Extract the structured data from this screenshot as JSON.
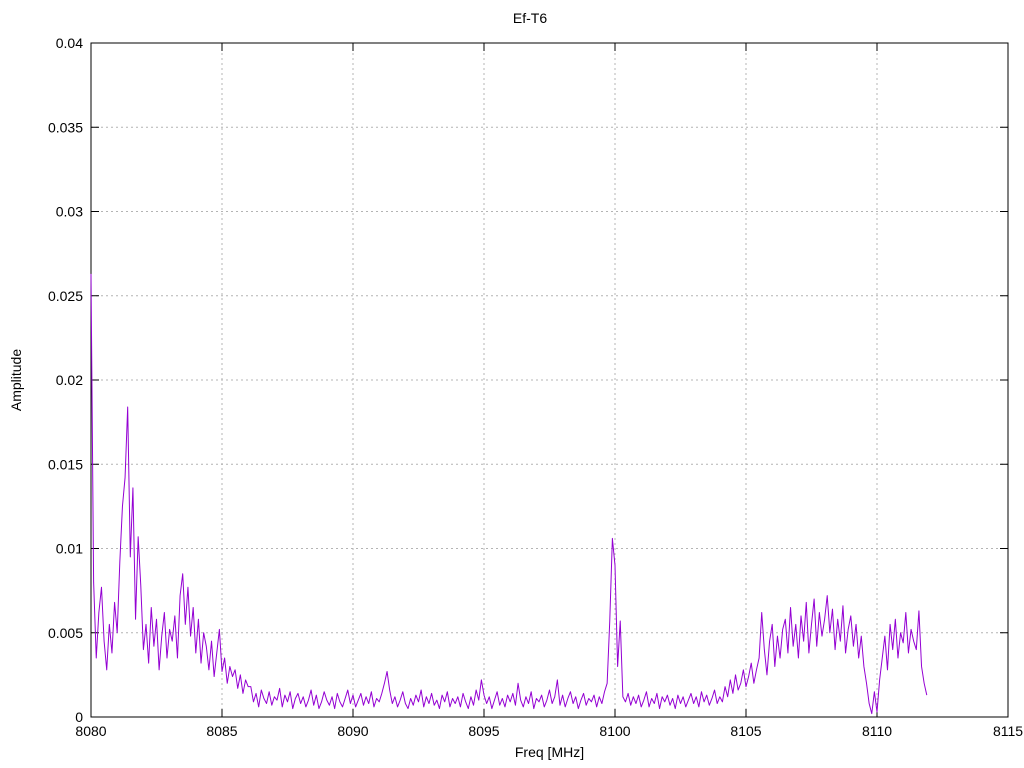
{
  "chart_data": {
    "type": "line",
    "title": "Ef-T6",
    "xlabel": "Freq [MHz]",
    "ylabel": "Amplitude",
    "xlim": [
      8080,
      8115
    ],
    "ylim": [
      0,
      0.04
    ],
    "grid": true,
    "legend_position": "none",
    "grid_color": "#b4b4b4",
    "axis_color": "#000000",
    "x_ticks": [
      {
        "value": 8080,
        "label": "8080"
      },
      {
        "value": 8085,
        "label": "8085"
      },
      {
        "value": 8090,
        "label": "8090"
      },
      {
        "value": 8095,
        "label": "8095"
      },
      {
        "value": 8100,
        "label": "8100"
      },
      {
        "value": 8105,
        "label": "8105"
      },
      {
        "value": 8110,
        "label": "8110"
      },
      {
        "value": 8115,
        "label": "8115"
      }
    ],
    "y_ticks": [
      {
        "value": 0,
        "label": "0"
      },
      {
        "value": 0.005,
        "label": "0.005"
      },
      {
        "value": 0.01,
        "label": "0.01"
      },
      {
        "value": 0.015,
        "label": "0.015"
      },
      {
        "value": 0.02,
        "label": "0.02"
      },
      {
        "value": 0.025,
        "label": "0.025"
      },
      {
        "value": 0.03,
        "label": "0.03"
      },
      {
        "value": 0.035,
        "label": "0.035"
      },
      {
        "value": 0.04,
        "label": "0.04"
      }
    ],
    "series": [
      {
        "name": "Ef-T6",
        "color": "#9400d3",
        "x_start": 8080.0,
        "x_step": 0.1,
        "amplitude_scale": 0.0001,
        "values": [
          263,
          80,
          35,
          62,
          77,
          45,
          28,
          55,
          38,
          68,
          50,
          92,
          125,
          142,
          184,
          95,
          136,
          58,
          107,
          78,
          40,
          55,
          32,
          65,
          42,
          58,
          28,
          48,
          62,
          35,
          52,
          45,
          60,
          35,
          72,
          85,
          55,
          77,
          48,
          65,
          38,
          58,
          32,
          50,
          42,
          28,
          45,
          24,
          38,
          52,
          27,
          35,
          20,
          30,
          24,
          28,
          17,
          25,
          14,
          22,
          18,
          18,
          9,
          14,
          6,
          16,
          11,
          8,
          15,
          7,
          12,
          10,
          17,
          6,
          13,
          9,
          15,
          5,
          11,
          14,
          8,
          12,
          6,
          10,
          16,
          7,
          13,
          5,
          9,
          15,
          10,
          7,
          12,
          5,
          14,
          9,
          6,
          11,
          16,
          8,
          13,
          6,
          10,
          14,
          7,
          12,
          8,
          15,
          6,
          11,
          9,
          14,
          20,
          27,
          16,
          8,
          12,
          6,
          10,
          15,
          8,
          5,
          11,
          7,
          13,
          9,
          16,
          6,
          12,
          8,
          14,
          7,
          10,
          5,
          13,
          9,
          15,
          6,
          11,
          8,
          12,
          6,
          14,
          9,
          5,
          12,
          7,
          16,
          10,
          22,
          13,
          8,
          12,
          5,
          10,
          15,
          7,
          11,
          6,
          13,
          9,
          14,
          7,
          20,
          10,
          6,
          12,
          8,
          15,
          5,
          11,
          9,
          13,
          6,
          10,
          16,
          8,
          12,
          22,
          7,
          13,
          6,
          11,
          15,
          8,
          12,
          5,
          10,
          14,
          7,
          11,
          9,
          13,
          6,
          12,
          8,
          15,
          20,
          57,
          106,
          90,
          30,
          57,
          12,
          9,
          14,
          7,
          12,
          8,
          13,
          6,
          10,
          15,
          6,
          11,
          8,
          14,
          5,
          12,
          9,
          13,
          7,
          11,
          5,
          13,
          8,
          12,
          6,
          10,
          14,
          8,
          12,
          6,
          15,
          9,
          13,
          7,
          11,
          16,
          8,
          12,
          9,
          18,
          12,
          22,
          14,
          25,
          16,
          20,
          28,
          18,
          24,
          32,
          20,
          28,
          35,
          62,
          40,
          25,
          45,
          55,
          30,
          48,
          35,
          52,
          58,
          38,
          65,
          42,
          55,
          35,
          60,
          45,
          68,
          38,
          55,
          70,
          42,
          62,
          48,
          58,
          72,
          50,
          64,
          40,
          58,
          45,
          66,
          38,
          52,
          60,
          42,
          55,
          35,
          48,
          30,
          20,
          8,
          2,
          15,
          3,
          22,
          35,
          48,
          28,
          55,
          40,
          58,
          35,
          50,
          44,
          62,
          38,
          52,
          45,
          40,
          63,
          30,
          20,
          13
        ]
      }
    ]
  }
}
